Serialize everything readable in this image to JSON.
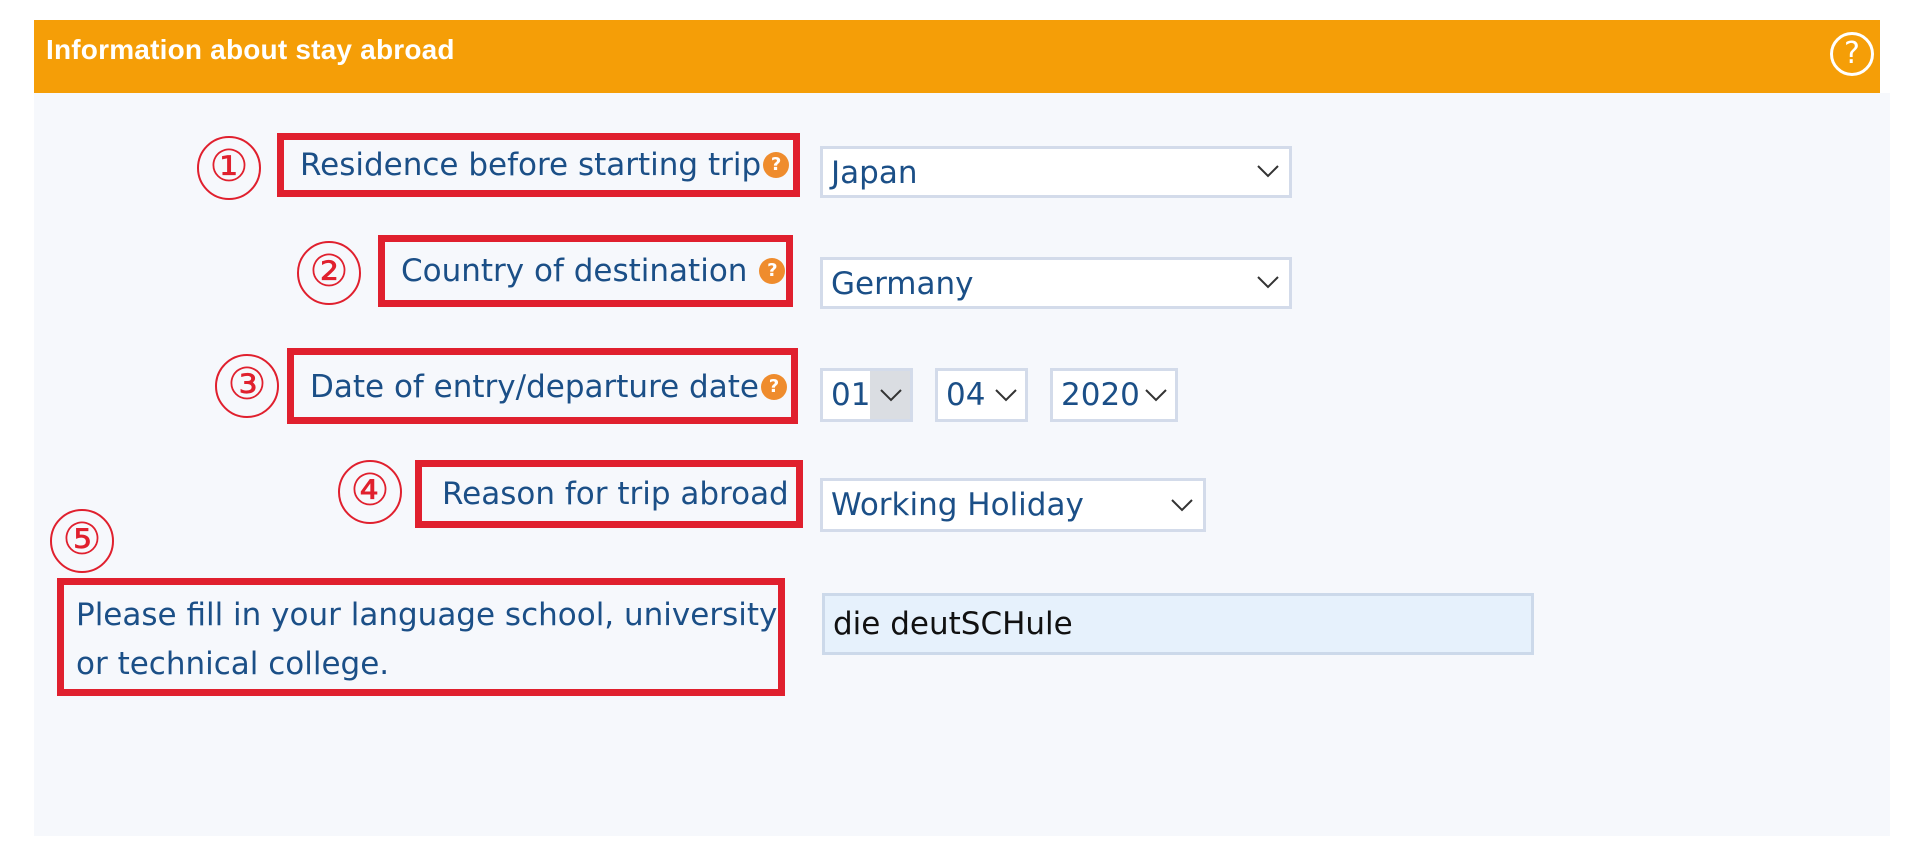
{
  "header": {
    "title": "Information about stay abroad",
    "help_glyph": "?"
  },
  "annotations": [
    "①",
    "②",
    "③",
    "④",
    "⑤"
  ],
  "form": {
    "help_glyph": "?",
    "residence": {
      "label": "Residence before starting trip",
      "value": "Japan"
    },
    "destination": {
      "label": "Country of destination",
      "value": "Germany"
    },
    "date": {
      "label": "Date of entry/departure date",
      "day": "01",
      "month": "04",
      "year": "2020"
    },
    "reason": {
      "label": "Reason for trip abroad",
      "value": "Working Holiday"
    },
    "school": {
      "label_line1": "Please fill in your language school, university",
      "label_line2": "or technical college.",
      "value": "die deutSCHule"
    }
  },
  "icons": {
    "dropdown": "chevron-down-icon",
    "info": "question-circle-icon"
  },
  "colors": {
    "header_bg": "#f59e07",
    "annotation_red": "#e0202e",
    "label_text": "#1b4f87",
    "info_icon": "#ef8c2d",
    "input_bg": "#e6f1fc"
  }
}
